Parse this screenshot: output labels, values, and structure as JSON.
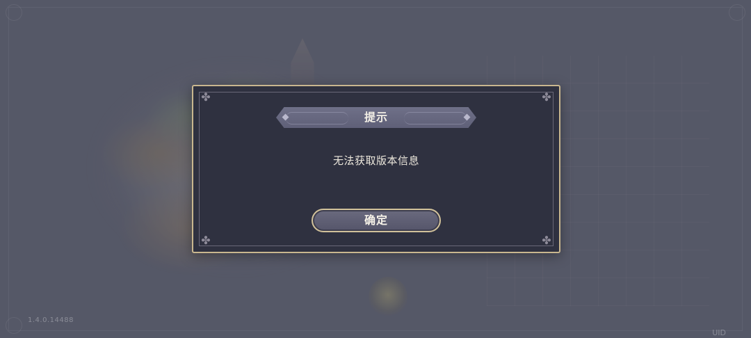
{
  "background": {
    "version": "1.4.0.14488",
    "uid_label": "UID"
  },
  "dialog": {
    "title": "提示",
    "message": "无法获取版本信息",
    "confirm_label": "确定"
  },
  "colors": {
    "dialog_bg": "#2f3140",
    "dialog_border": "#c9b78f",
    "banner_bg": "#6f7088",
    "button_border": "#d2c29a",
    "text_primary": "#f3efe6"
  },
  "icons": {
    "corner_ornament": "fleur-corner-icon",
    "banner_diamond": "diamond-icon"
  }
}
